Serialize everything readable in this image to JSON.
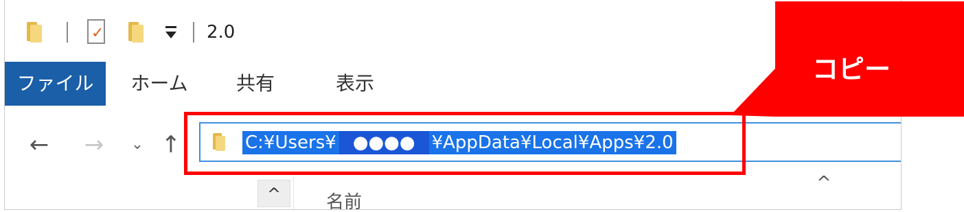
{
  "title_bar": {
    "title": "2.0",
    "icons": [
      "folder-icon",
      "properties-icon",
      "new-folder-icon",
      "customize-qat-icon"
    ]
  },
  "ribbon": {
    "tabs": [
      {
        "label": "ファイル",
        "active": true
      },
      {
        "label": "ホーム"
      },
      {
        "label": "共有"
      },
      {
        "label": "表示"
      }
    ]
  },
  "nav": {
    "icons": [
      "back-arrow-icon",
      "forward-arrow-icon",
      "recent-locations-chevron-icon",
      "up-arrow-icon"
    ]
  },
  "address_bar": {
    "path_prefix": "C:¥Users¥",
    "masked_user": "●●●●",
    "path_suffix": "¥AppData¥Local¥Apps¥2.0",
    "selected": true
  },
  "file_list": {
    "sort_glyph": "^",
    "column_name": "名前",
    "column_chevron": "^"
  },
  "callout": {
    "label": "コピー",
    "color": "#ff0000"
  },
  "colors": {
    "file_tab": "#1a5fa8",
    "selection": "#1a73e8",
    "focus_border": "#3d8fde"
  }
}
